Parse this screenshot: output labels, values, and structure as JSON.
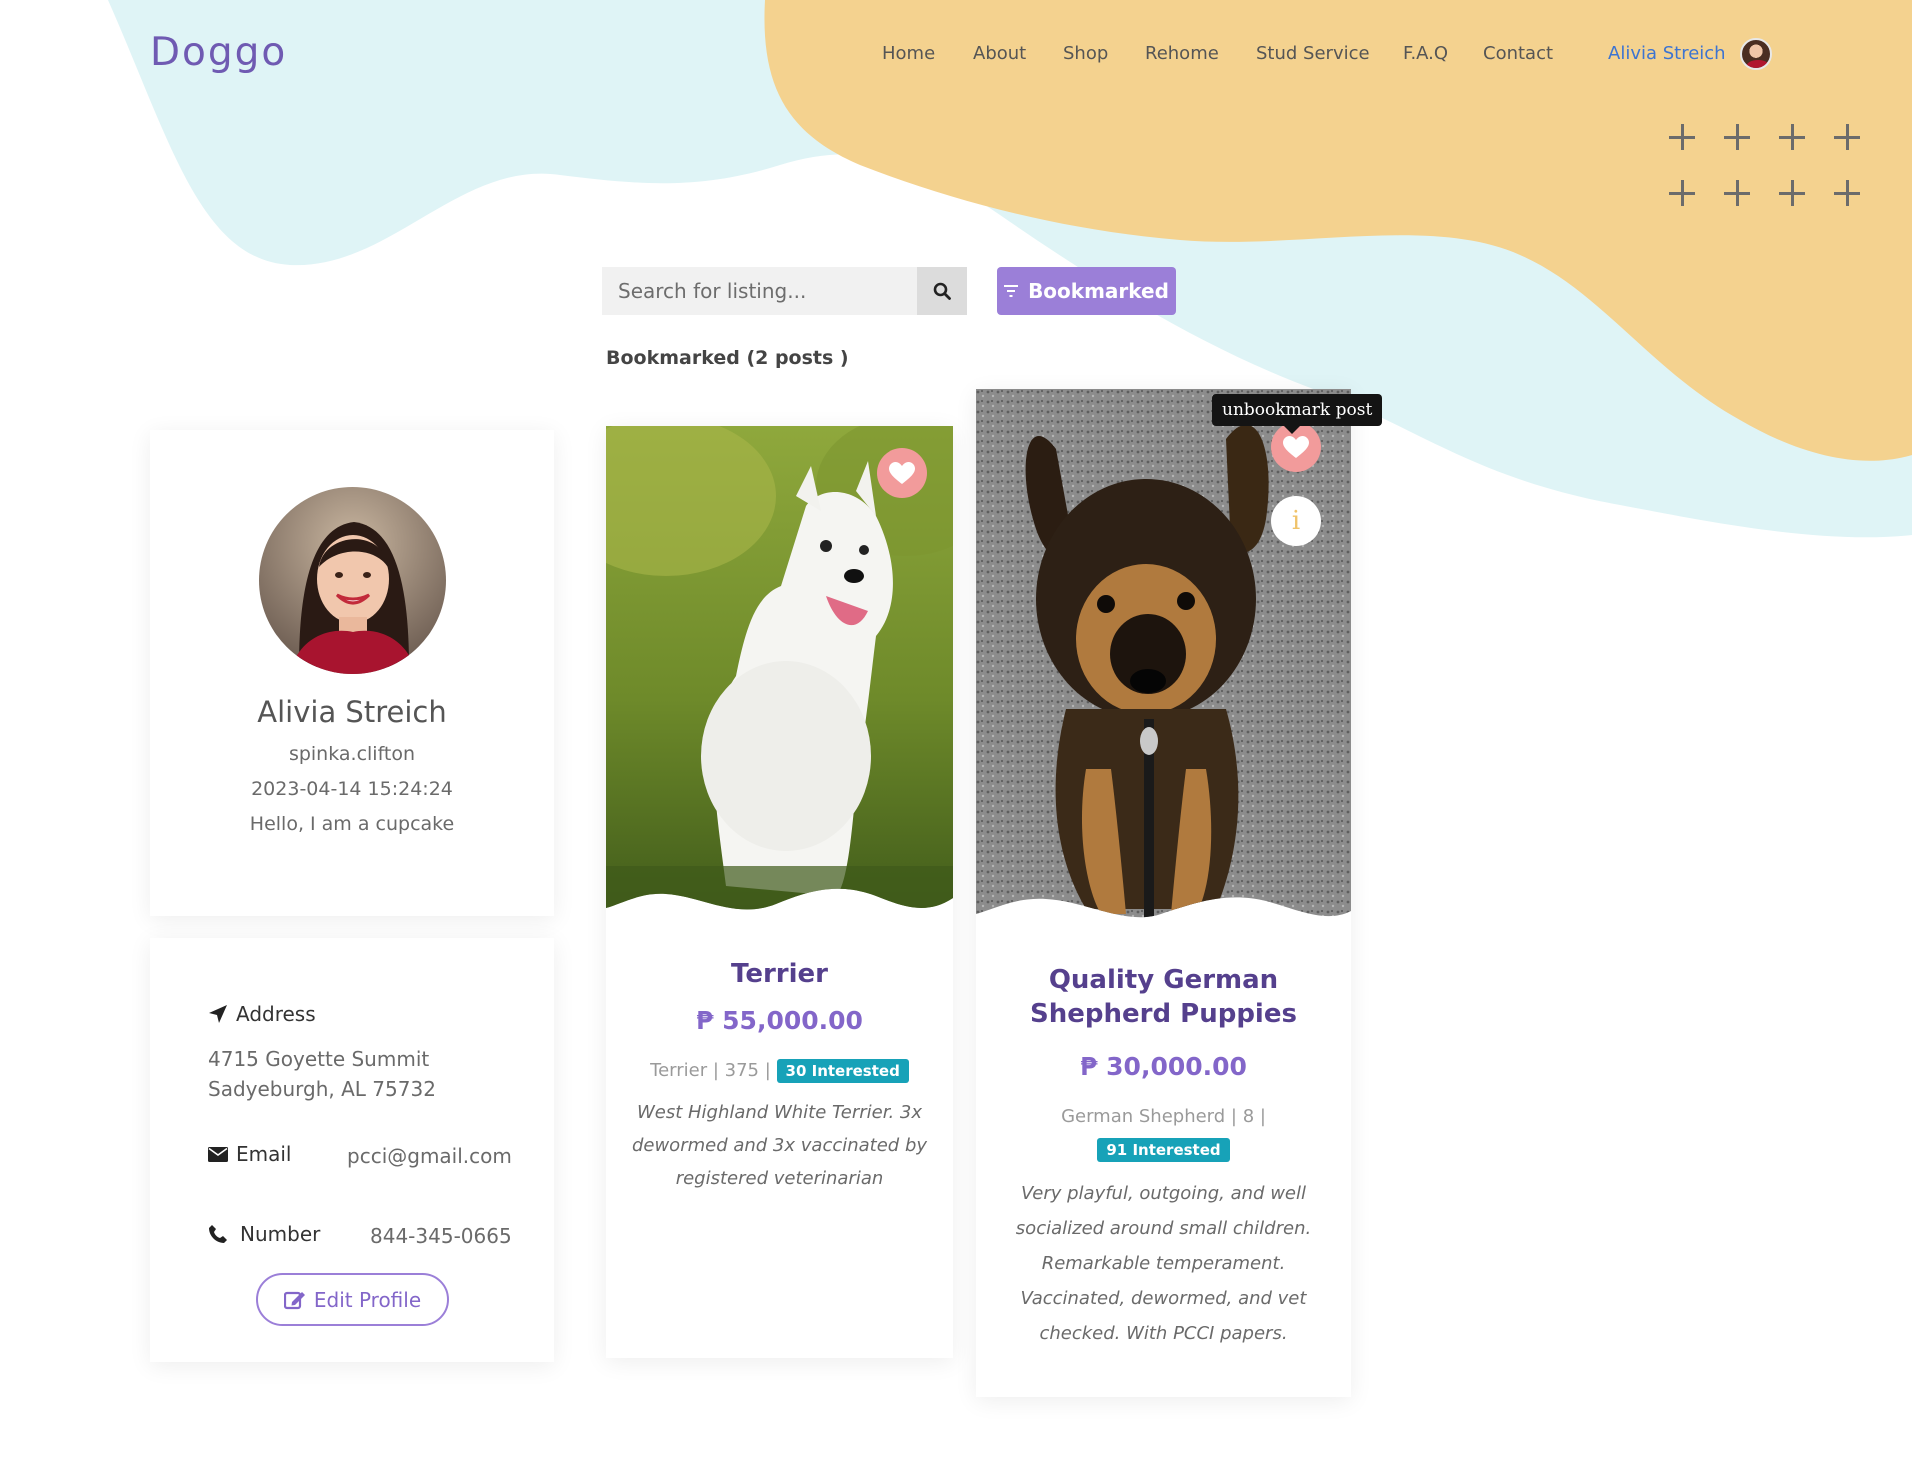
{
  "brand": {
    "logo": "Doggo"
  },
  "nav": {
    "items": [
      "Home",
      "About",
      "Shop",
      "Rehome",
      "Stud Service",
      "F.A.Q",
      "Contact"
    ],
    "user_name": "Alivia Streich"
  },
  "search": {
    "placeholder": "Search for listing...",
    "filter_label": "Bookmarked"
  },
  "section_title": "Bookmarked (2 posts )",
  "profile": {
    "name": "Alivia Streich",
    "username": "spinka.clifton",
    "joined": "2023-04-14 15:24:24",
    "bio": "Hello, I am a cupcake"
  },
  "contact": {
    "address_label": "Address",
    "address_line1": "4715 Goyette Summit",
    "address_line2": "Sadyeburgh, AL 75732",
    "email_label": "Email",
    "email": "pcci@gmail.com",
    "number_label": "Number",
    "number": "844-345-0665",
    "edit_label": "Edit Profile"
  },
  "listings": [
    {
      "title": "Terrier",
      "price": "₱ 55,000.00",
      "meta": "Terrier | 375 |",
      "interested": "30 Interested",
      "description": "West Highland White Terrier. 3x dewormed and 3x vaccinated by registered veterinarian"
    },
    {
      "title_line1": "Quality German",
      "title_line2": "Shepherd Puppies",
      "price": "₱ 30,000.00",
      "meta": "German Shepherd | 8 |",
      "interested": "91 Interested",
      "description": "Very playful, outgoing, and well socialized around small children. Remarkable temperament. Vaccinated, dewormed, and vet checked. With PCCI papers.",
      "tooltip": "unbookmark post",
      "info_glyph": "i"
    }
  ],
  "colors": {
    "brand_purple": "#6f5ab2",
    "button_purple": "#9b7fd8",
    "badge_teal": "#17a2b8",
    "blob_yellow": "#f4d28f",
    "blob_cyan": "#dff4f6",
    "heart_pink": "#f29b9b"
  },
  "icons": [
    "search-icon",
    "filter-icon",
    "location-arrow-icon",
    "envelope-icon",
    "phone-icon",
    "edit-icon",
    "heart-icon",
    "info-icon",
    "plus-icon"
  ]
}
